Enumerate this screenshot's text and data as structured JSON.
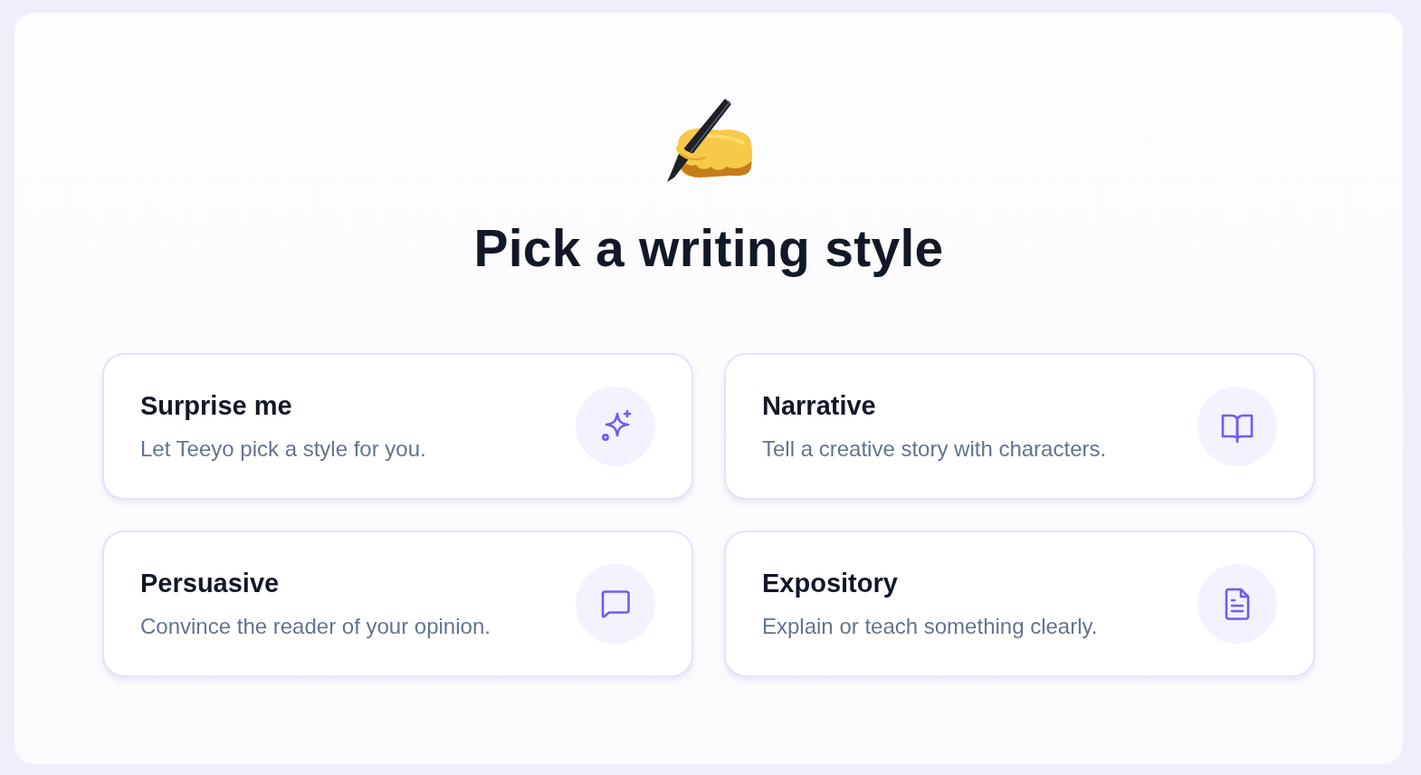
{
  "header": {
    "title": "Pick a writing style"
  },
  "options": [
    {
      "kind": "sparkles",
      "title": "Surprise me",
      "description": "Let Teeyo pick a style for you."
    },
    {
      "kind": "book",
      "title": "Narrative",
      "description": "Tell a creative story with characters."
    },
    {
      "kind": "chat",
      "title": "Persuasive",
      "description": "Convince the reader of your opinion."
    },
    {
      "kind": "document",
      "title": "Expository",
      "description": "Explain or teach something clearly."
    }
  ]
}
